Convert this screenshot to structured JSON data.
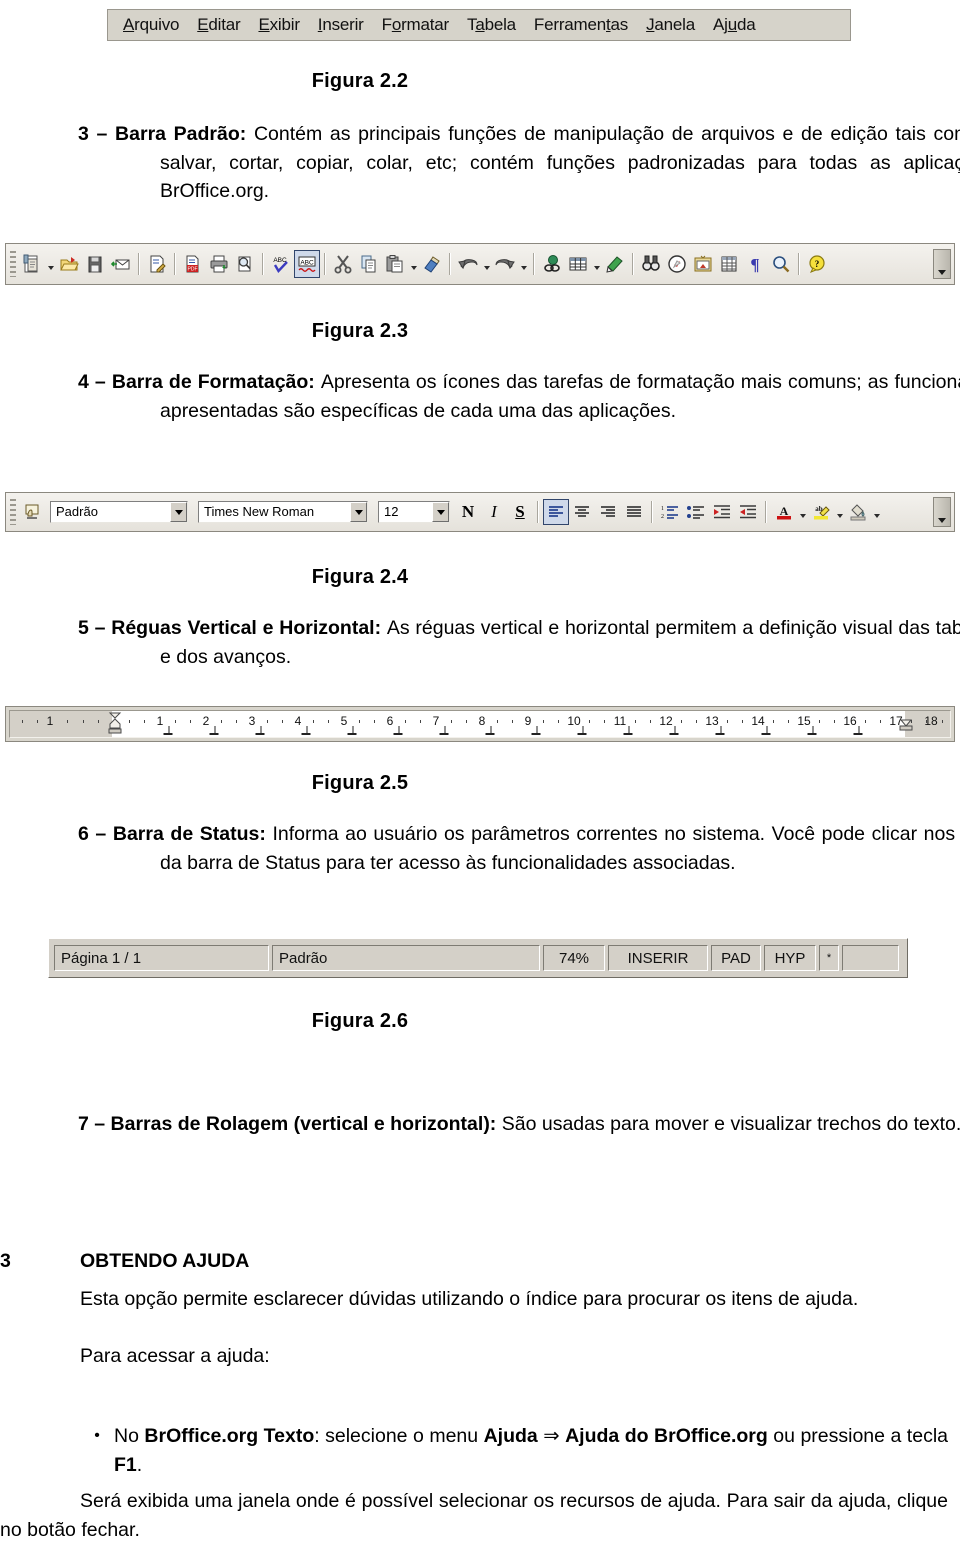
{
  "figures": {
    "fig22_caption": "Figura 2.2",
    "fig23_caption": "Figura 2.3",
    "fig24_caption": "Figura 2.4",
    "fig25_caption": "Figura 2.5",
    "fig26_caption": "Figura 2.6"
  },
  "menubar": {
    "items": [
      {
        "pre": "",
        "mnemonic": "A",
        "post": "rquivo"
      },
      {
        "pre": "",
        "mnemonic": "E",
        "post": "ditar"
      },
      {
        "pre": "",
        "mnemonic": "E",
        "post": "xibir"
      },
      {
        "pre": "",
        "mnemonic": "I",
        "post": "nserir"
      },
      {
        "pre": "F",
        "mnemonic": "o",
        "post": "rmatar"
      },
      {
        "pre": "T",
        "mnemonic": "a",
        "post": "bela"
      },
      {
        "pre": "Ferramen",
        "mnemonic": "t",
        "post": "as"
      },
      {
        "pre": "",
        "mnemonic": "J",
        "post": "anela"
      },
      {
        "pre": "Aj",
        "mnemonic": "u",
        "post": "da"
      }
    ]
  },
  "standard_toolbar": {
    "icons": [
      "new-document-icon",
      "open-document-icon",
      "save-document-icon",
      "send-email-icon",
      "edit-file-icon",
      "export-pdf-icon",
      "print-file-icon",
      "print-preview-icon",
      "spellcheck-icon",
      "autospellcheck-icon",
      "cut-icon",
      "copy-icon",
      "paste-icon",
      "clone-formatting-icon",
      "undo-icon",
      "redo-icon",
      "hyperlink-icon",
      "table-icon",
      "show-draw-functions-icon",
      "find-replace-icon",
      "navigator-icon",
      "gallery-icon",
      "data-sources-icon",
      "formatting-marks-icon",
      "zoom-icon",
      "help-icon"
    ]
  },
  "formatting_toolbar": {
    "style_value": "Padrão",
    "font_value": "Times New Roman",
    "size_value": "12",
    "bold_label": "N",
    "italic_label": "I",
    "underline_label": "S",
    "icons": [
      "paragraph-style-icon",
      "align-left-icon",
      "align-center-icon",
      "align-right-icon",
      "justify-icon",
      "ordered-list-icon",
      "unordered-list-icon",
      "decrease-indent-icon",
      "increase-indent-icon",
      "font-color-icon",
      "highlighting-icon",
      "background-color-icon"
    ]
  },
  "ruler": {
    "margin_number": "1",
    "numbers": [
      "1",
      "2",
      "3",
      "4",
      "5",
      "6",
      "7",
      "8",
      "9",
      "10",
      "11",
      "12",
      "13",
      "14",
      "15",
      "16",
      "17",
      "18"
    ]
  },
  "statusbar": {
    "page": "Página 1 / 1",
    "style": "Padrão",
    "zoom": "74%",
    "insert_mode": "INSERIR",
    "selection_mode": "PAD",
    "hyphenation": "HYP",
    "modified": "*"
  },
  "body": {
    "item3": {
      "number": "3 – ",
      "title": "Barra Padrão: ",
      "text": "Contém as principais funções de manipulação de arquivos e de edição tais como:abrir, salvar, cortar, copiar, colar, etc; contém funções padronizadas para todas as aplicações do BrOffice.org."
    },
    "item4": {
      "number": "4 – ",
      "title": "Barra de Formatação: ",
      "text": "Apresenta os ícones das tarefas de formatação mais comuns; as funcionalidades apresentadas são específicas de cada uma das aplicações."
    },
    "item5": {
      "number": "5 – ",
      "title": "Réguas Vertical e Horizontal: ",
      "text": "As réguas vertical e horizontal permitem a definição visual das tabulações e dos avanços."
    },
    "item6": {
      "number": "6 – ",
      "title": "Barra de Status: ",
      "text": "Informa ao usuário os parâmetros correntes no sistema. Você pode clicar nos campos da barra de Status para ter acesso às funcionalidades associadas."
    },
    "item7": {
      "number": "7 – ",
      "title": "Barras de Rolagem (vertical e horizontal): ",
      "text": "São usadas para mover e visualizar trechos do texto."
    },
    "section3": {
      "number": "3",
      "heading": "OBTENDO AJUDA",
      "para1": "Esta opção permite esclarecer dúvidas utilizando o índice para procurar os itens de ajuda.",
      "para2": "Para acessar a ajuda:",
      "bullet": {
        "glyph": "•",
        "part1": "No ",
        "bold1": "BrOffice.org Texto",
        "part2": ": selecione o menu ",
        "bold2": "Ajuda",
        "arrow": " ⇒ ",
        "bold3": "Ajuda do BrOffice.org",
        "part3": " ou pressione a tecla ",
        "bold4": "F1",
        "part4": "."
      },
      "para3": "Será exibida uma janela onde é possível selecionar os recursos de ajuda. Para sair da ajuda, clique no botão fechar."
    }
  }
}
